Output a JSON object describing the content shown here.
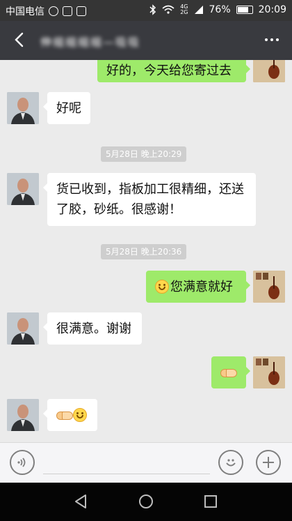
{
  "status_bar": {
    "carrier": "中国电信",
    "network": "4G",
    "network2": "2G",
    "battery": "76%",
    "time": "20:09"
  },
  "header": {
    "title": "伸缩缩缩缩—吸吸",
    "more_icon": "more-icon"
  },
  "messages": [
    {
      "side": "right",
      "text": "好的，今天给您寄过去"
    },
    {
      "side": "left",
      "text": "好呢"
    },
    {
      "timestamp": "5月28日 晚上20:29"
    },
    {
      "side": "left",
      "text": "货已收到，指板加工很精细，还送了胶，砂纸。很感谢！"
    },
    {
      "timestamp": "5月28日 晚上20:36"
    },
    {
      "side": "right",
      "emoji": "smile",
      "text": "您满意就好"
    },
    {
      "side": "left",
      "text": "很满意。谢谢"
    },
    {
      "side": "right",
      "emoji": "handshake"
    },
    {
      "side": "left",
      "emoji": [
        "handshake",
        "smile"
      ]
    }
  ],
  "input_bar": {
    "voice_icon": "voice-icon",
    "emoji_icon": "emoji-icon",
    "plus_icon": "plus-icon",
    "placeholder": ""
  },
  "nav_bar": {
    "icons": [
      "back-icon",
      "home-icon",
      "recents-icon"
    ]
  },
  "colors": {
    "accent": "#9eea6a",
    "header": "#393a3f",
    "background": "#ebebeb"
  }
}
